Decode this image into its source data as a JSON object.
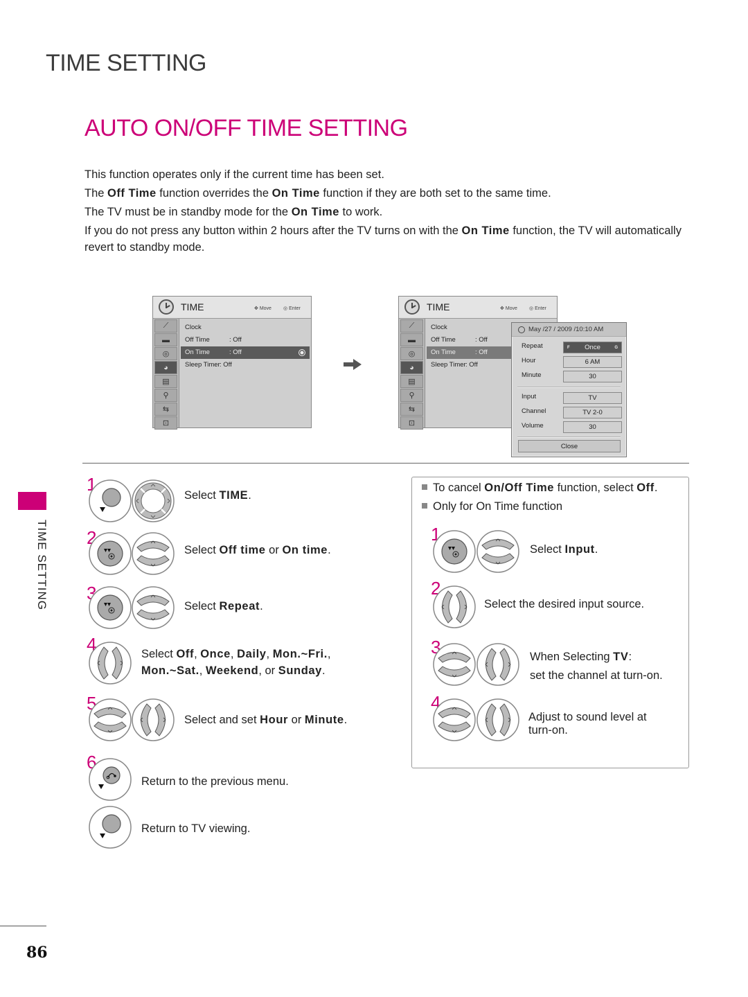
{
  "header": {
    "page_title": "TIME SETTING",
    "section_title": "AUTO ON/OFF TIME SETTING"
  },
  "description": [
    {
      "parts": [
        {
          "t": "This function operates only if the current time has been set.",
          "b": false
        }
      ]
    },
    {
      "parts": [
        {
          "t": "The ",
          "b": false
        },
        {
          "t": "Off Time",
          "b": true
        },
        {
          "t": " function overrides the ",
          "b": false
        },
        {
          "t": "On Time",
          "b": true
        },
        {
          "t": " function if they are both set to the same time.",
          "b": false
        }
      ]
    },
    {
      "parts": [
        {
          "t": "The TV must be in standby mode for the ",
          "b": false
        },
        {
          "t": "On Time",
          "b": true
        },
        {
          "t": " to work.",
          "b": false
        }
      ]
    },
    {
      "parts": [
        {
          "t": "If you do not press any button within 2 hours after the TV turns on with the ",
          "b": false
        },
        {
          "t": "On Time",
          "b": true
        },
        {
          "t": " function, the TV will automatically revert to standby mode.",
          "b": false
        }
      ]
    }
  ],
  "menu_left": {
    "title": "TIME",
    "hint_move": "Move",
    "hint_enter": "Enter",
    "items": [
      {
        "label": "Clock",
        "value": ""
      },
      {
        "label": "Off Time",
        "value": ": Off"
      },
      {
        "label": "On Time",
        "value": ": Off",
        "selected": true
      },
      {
        "label": "Sleep Timer",
        "value": ": Off"
      }
    ],
    "side_icons": [
      "picture-setup-icon",
      "screen-icon",
      "audio-icon",
      "time-icon",
      "option-icon",
      "lock-icon",
      "input-icon",
      "usb-icon"
    ]
  },
  "menu_right": {
    "title": "TIME",
    "hint_move": "Move",
    "hint_enter": "Enter",
    "items": [
      {
        "label": "Clock",
        "value": ""
      },
      {
        "label": "Off Time",
        "value": ": Off"
      },
      {
        "label": "On Time",
        "value": ": Off",
        "selected": true
      },
      {
        "label": "Sleep Timer",
        "value": ": Off"
      }
    ]
  },
  "popup": {
    "datetime": "May /27 / 2009 /10:10 AM",
    "repeat_label": "Repeat",
    "repeat_value": "Once",
    "repeat_left": "F",
    "repeat_right": "G",
    "hour_label": "Hour",
    "hour_value": "6 AM",
    "minute_label": "Minute",
    "minute_value": "30",
    "input_label": "Input",
    "input_value": "TV",
    "channel_label": "Channel",
    "channel_value": "TV 2-0",
    "volume_label": "Volume",
    "volume_value": "30",
    "close_label": "Close"
  },
  "side_tab": {
    "label": "TIME SETTING",
    "accent_color": "#cc0077"
  },
  "page_number": "86",
  "steps_left": [
    {
      "num": "1",
      "text": [
        {
          "t": "Select ",
          "b": false
        },
        {
          "t": "TIME",
          "b": true
        },
        {
          "t": ".",
          "b": false
        }
      ]
    },
    {
      "num": "2",
      "text": [
        {
          "t": "Select ",
          "b": false
        },
        {
          "t": "Off time",
          "b": true
        },
        {
          "t": " or ",
          "b": false
        },
        {
          "t": "On time",
          "b": true
        },
        {
          "t": ".",
          "b": false
        }
      ]
    },
    {
      "num": "3",
      "text": [
        {
          "t": "Select ",
          "b": false
        },
        {
          "t": "Repeat",
          "b": true
        },
        {
          "t": ".",
          "b": false
        }
      ]
    },
    {
      "num": "4",
      "text": [
        {
          "t": "Select ",
          "b": false
        },
        {
          "t": "Off",
          "b": true
        },
        {
          "t": ", ",
          "b": false
        },
        {
          "t": "Once",
          "b": true
        },
        {
          "t": ", ",
          "b": false
        },
        {
          "t": "Daily",
          "b": true
        },
        {
          "t": ", ",
          "b": false
        },
        {
          "t": "Mon.~Fri.",
          "b": true
        },
        {
          "t": ", ",
          "b": false
        },
        {
          "t": "Mon.~Sat.",
          "b": true
        },
        {
          "t": ", ",
          "b": false
        },
        {
          "t": "Weekend",
          "b": true
        },
        {
          "t": ", or ",
          "b": false
        },
        {
          "t": "Sunday",
          "b": true
        },
        {
          "t": ".",
          "b": false
        }
      ]
    },
    {
      "num": "5",
      "text": [
        {
          "t": "Select and set ",
          "b": false
        },
        {
          "t": "Hour",
          "b": true
        },
        {
          "t": " or ",
          "b": false
        },
        {
          "t": "Minute",
          "b": true
        },
        {
          "t": ".",
          "b": false
        }
      ]
    },
    {
      "num": "6",
      "text": [
        {
          "t": "Return to the previous menu.",
          "b": false
        }
      ]
    },
    {
      "num": "",
      "text": [
        {
          "t": "Return to TV viewing.",
          "b": false
        }
      ]
    }
  ],
  "notes": {
    "bullets": [
      [
        {
          "t": "To cancel ",
          "b": false
        },
        {
          "t": "On/Off Time",
          "b": true
        },
        {
          "t": " function, select ",
          "b": false
        },
        {
          "t": "Off",
          "b": true
        },
        {
          "t": ".",
          "b": false
        }
      ],
      [
        {
          "t": "Only for On Time function",
          "b": false
        }
      ]
    ],
    "steps": [
      {
        "num": "1",
        "text": [
          {
            "t": "Select ",
            "b": false
          },
          {
            "t": "Input",
            "b": true
          },
          {
            "t": ".",
            "b": false
          }
        ]
      },
      {
        "num": "2",
        "text": [
          {
            "t": "Select the desired input source.",
            "b": false
          }
        ]
      },
      {
        "num": "3",
        "text": [
          {
            "t": "When Selecting ",
            "b": false
          },
          {
            "t": "TV",
            "b": true
          },
          {
            "t": ":",
            "b": false
          }
        ],
        "text2": "set the channel at turn-on."
      },
      {
        "num": "4",
        "text": [
          {
            "t": "Adjust to sound level at turn-on.",
            "b": false
          }
        ]
      }
    ]
  }
}
